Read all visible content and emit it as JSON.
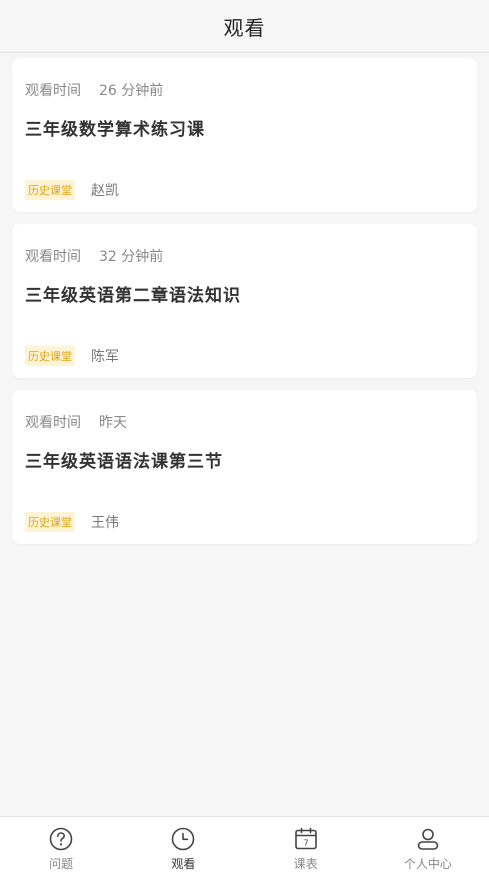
{
  "header": {
    "title": "观看"
  },
  "records": [
    {
      "time_label": "观看时间",
      "time_value": "26 分钟前",
      "course_title": "三年级数学算术练习课",
      "tag": "历史课堂",
      "teacher": "赵凯"
    },
    {
      "time_label": "观看时间",
      "time_value": "32 分钟前",
      "course_title": "三年级英语第二章语法知识",
      "tag": "历史课堂",
      "teacher": "陈军"
    },
    {
      "time_label": "观看时间",
      "time_value": "昨天",
      "course_title": "三年级英语语法课第三节",
      "tag": "历史课堂",
      "teacher": "王伟"
    }
  ],
  "tabbar": {
    "active": "观看",
    "items": [
      {
        "label": "问题",
        "icon": "question-circle-icon"
      },
      {
        "label": "观看",
        "icon": "clock-icon"
      },
      {
        "label": "课表",
        "icon": "calendar-icon",
        "icon_text": "7"
      },
      {
        "label": "个人中心",
        "icon": "person-icon"
      }
    ]
  },
  "colors": {
    "tag_bg": "#fdf3d5",
    "tag_text": "#e0a41a",
    "background": "#f5f6f5"
  }
}
